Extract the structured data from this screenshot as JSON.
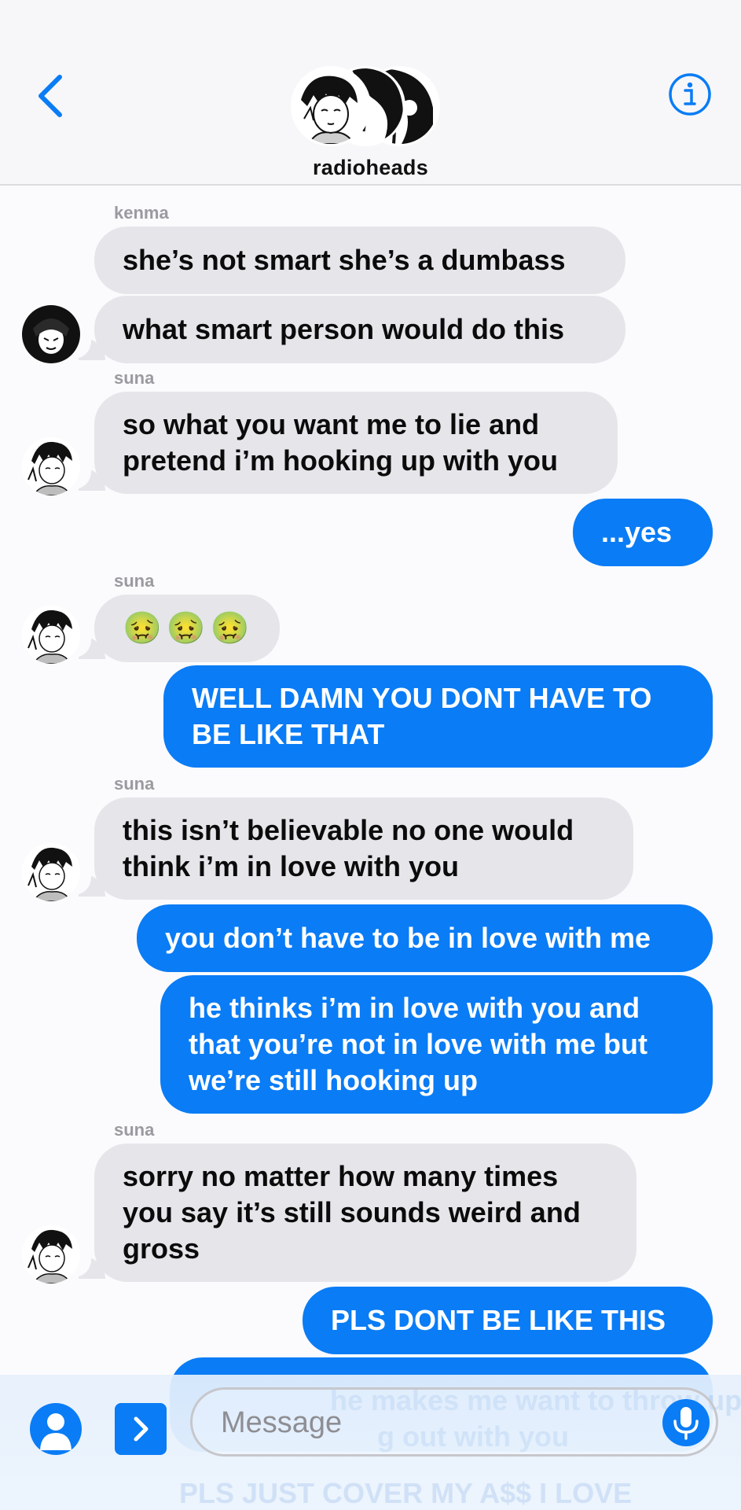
{
  "header": {
    "group_name": "radioheads"
  },
  "messages": [
    {
      "type": "in",
      "sender": "kenma",
      "lines": [
        "she’s not smart she’s a dumbass"
      ]
    },
    {
      "type": "in",
      "lines": [
        "what smart person would do this"
      ]
    },
    {
      "type": "in",
      "sender": "suna",
      "lines": [
        "so what you want me to lie and",
        "pretend i’m hooking up with you"
      ]
    },
    {
      "type": "out",
      "lines": [
        "...yes"
      ]
    },
    {
      "type": "in",
      "sender": "suna",
      "emoji": [
        "🤢",
        "🤢",
        "🤢"
      ]
    },
    {
      "type": "out",
      "lines": [
        "WELL DAMN YOU DONT HAVE TO",
        "BE LIKE THAT"
      ]
    },
    {
      "type": "in",
      "sender": "suna",
      "lines": [
        "this isn’t believable no one would",
        "think i’m in love with you"
      ]
    },
    {
      "type": "out",
      "lines": [
        "you don’t have to be in love with me"
      ]
    },
    {
      "type": "out",
      "lines": [
        "he thinks i’m in love with you and",
        "that you’re not in love with me but",
        "we’re still hooking up"
      ]
    },
    {
      "type": "in",
      "sender": "suna",
      "lines": [
        "sorry no matter how many times",
        "you say it’s still sounds weird and",
        "gross"
      ]
    },
    {
      "type": "out",
      "lines": [
        "PLS DONT BE LIKE THIS"
      ]
    }
  ],
  "ghost_text": [
    "he makes me want to throw up",
    "g out with you",
    "PLS JUST COVER MY A$$ I LOVE"
  ],
  "composer": {
    "placeholder": "Message"
  },
  "colors": {
    "accent": "#0a7cf5",
    "incoming_bubble": "#e6e5ea",
    "background": "#fbfbfd"
  }
}
